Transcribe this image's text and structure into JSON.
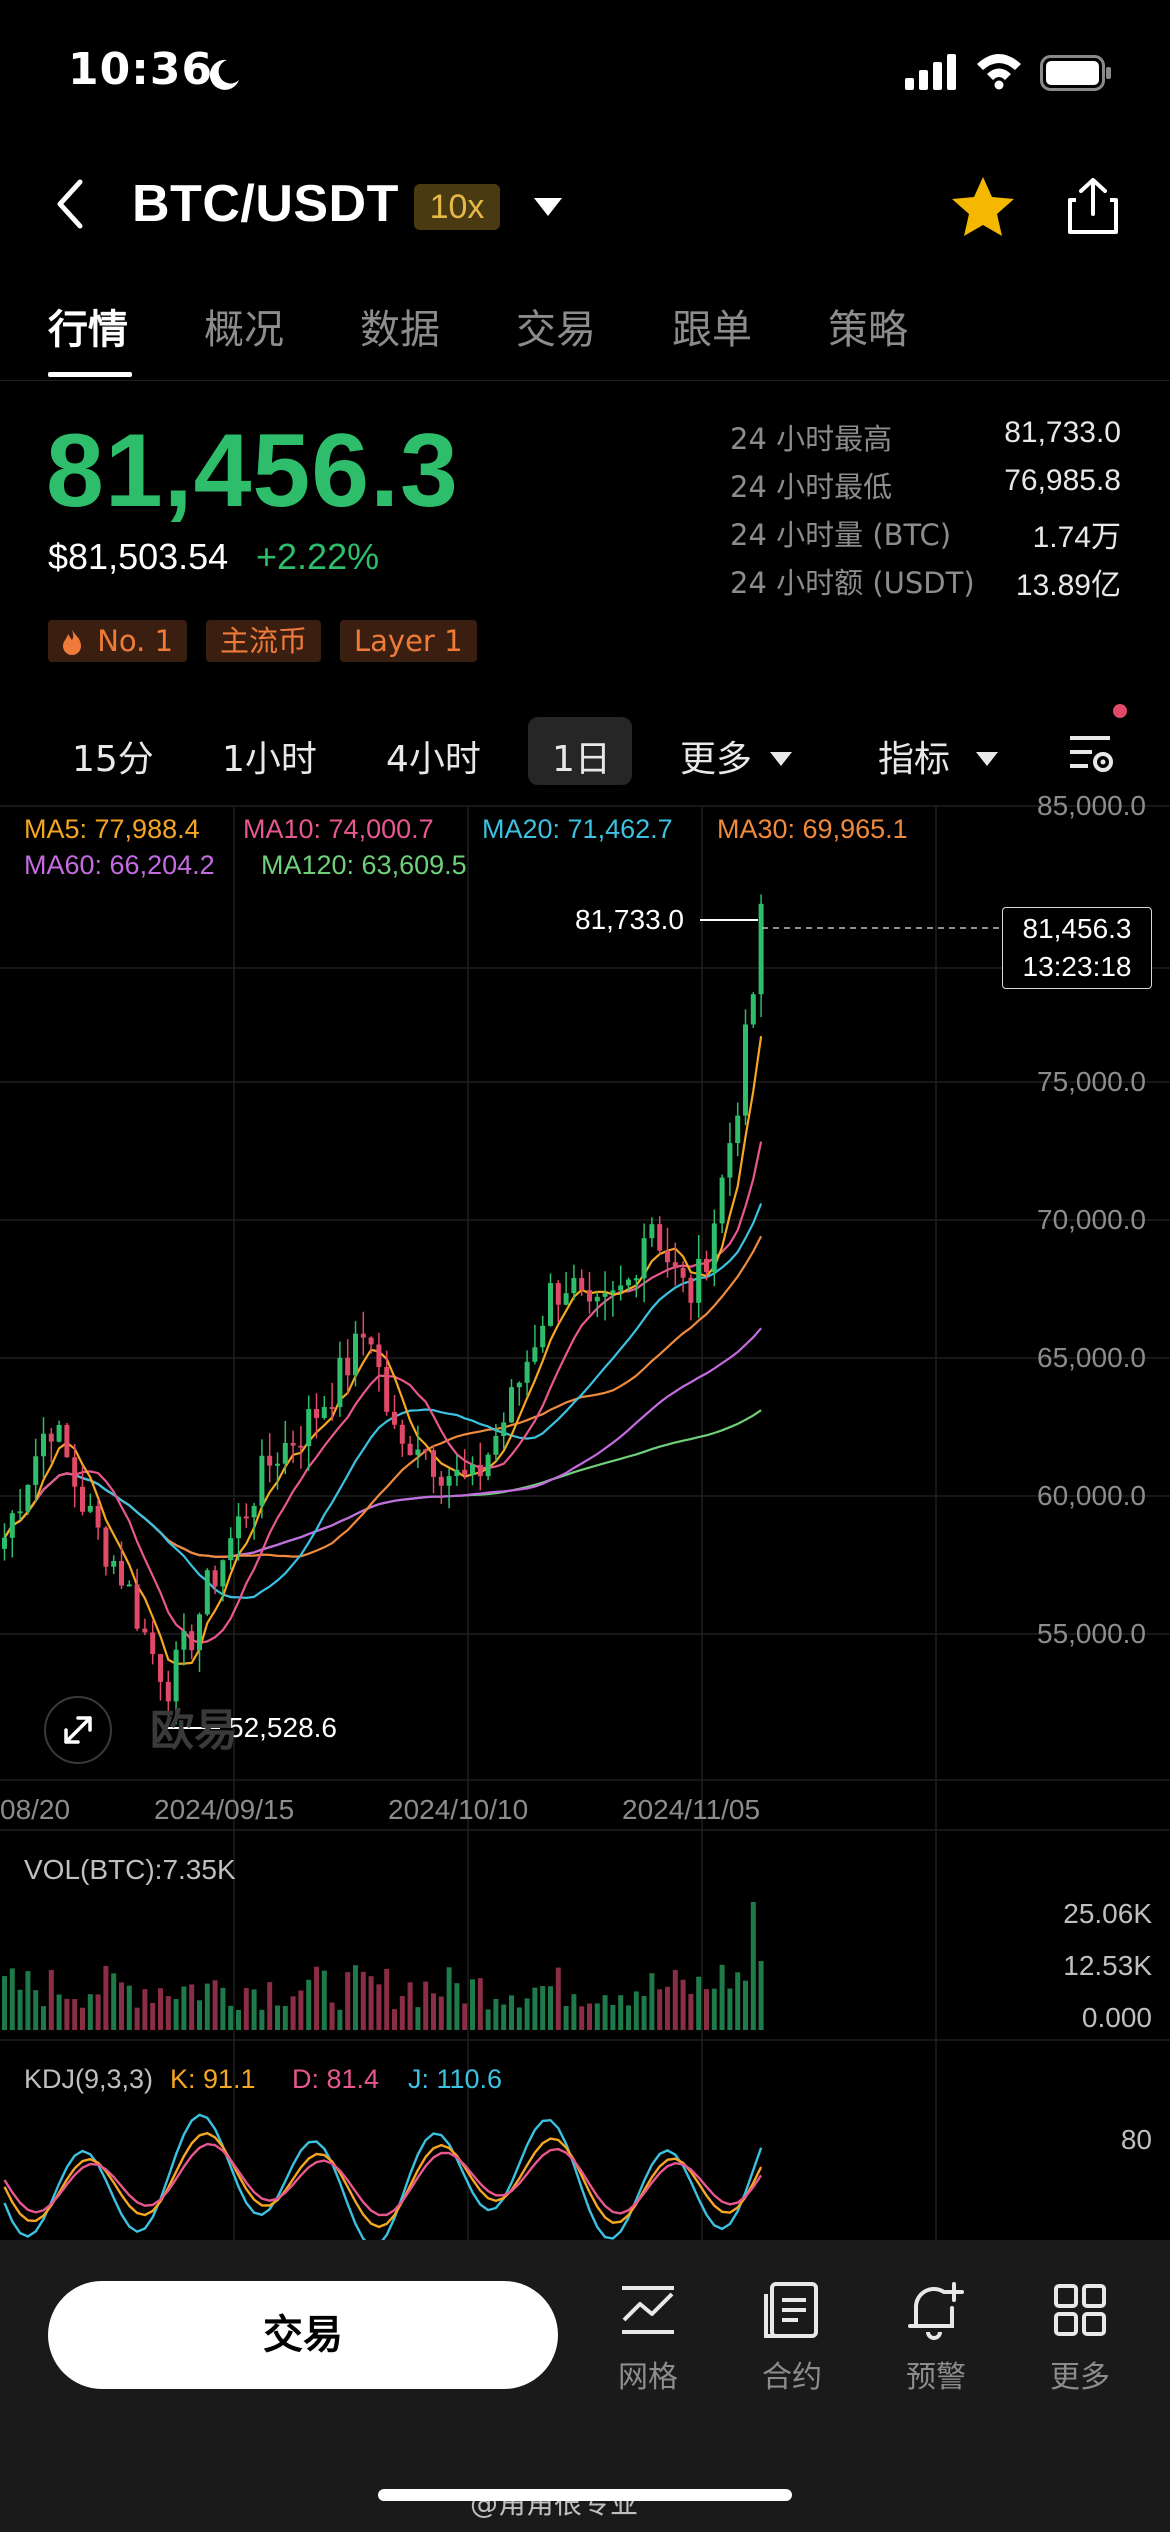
{
  "status": {
    "time": "10:36"
  },
  "header": {
    "pair": "BTC/USDT",
    "leverage": "10x"
  },
  "tabs": [
    "行情",
    "概况",
    "数据",
    "交易",
    "跟单",
    "策略"
  ],
  "price": {
    "last": "81,456.3",
    "usd": "$81,503.54",
    "change": "+2.22%"
  },
  "tags": [
    "No. 1",
    "主流币",
    "Layer 1"
  ],
  "stats": [
    {
      "label": "24 小时最高",
      "value": "81,733.0"
    },
    {
      "label": "24 小时最低",
      "value": "76,985.8"
    },
    {
      "label": "24 小时量 (BTC)",
      "value": "1.74万"
    },
    {
      "label": "24 小时额 (USDT)",
      "value": "13.89亿"
    }
  ],
  "intervals": {
    "m15": "15分",
    "h1": "1小时",
    "h4": "4小时",
    "d1": "1日",
    "more": "更多",
    "indicator": "指标"
  },
  "ma": {
    "ma5": "MA5: 77,988.4",
    "ma10": "MA10: 74,000.7",
    "ma20": "MA20: 71,462.7",
    "ma30": "MA30: 69,965.1",
    "ma60": "MA60: 66,204.2",
    "ma120": "MA120: 63,609.5"
  },
  "colors": {
    "up": "#2ebd6b",
    "down": "#e04a68",
    "ma5": "#f5a623",
    "ma10": "#e8578f",
    "ma20": "#3cc2e0",
    "ma30": "#f08a3c",
    "ma60": "#c46be0",
    "ma120": "#6fd07a"
  },
  "chart": {
    "y_labels": [
      "85,000.0",
      "75,000.0",
      "70,000.0",
      "65,000.0",
      "60,000.0",
      "55,000.0"
    ],
    "x_labels": [
      "08/20",
      "2024/09/15",
      "2024/10/10",
      "2024/11/05"
    ],
    "high_marker": "81,733.0",
    "low_marker": "52,528.6",
    "current_price": "81,456.3",
    "countdown": "13:23:18",
    "watermark": "欧易"
  },
  "volume": {
    "title": "VOL(BTC):7.35K",
    "labels": [
      "25.06K",
      "12.53K",
      "0.000"
    ]
  },
  "kdj": {
    "title": "KDJ(9,3,3)",
    "k": "K: 91.1",
    "d": "D: 81.4",
    "j": "J: 110.6",
    "level": "80"
  },
  "bottom": {
    "trade": "交易",
    "grid": "网格",
    "contract": "合约",
    "alert": "预警",
    "more": "更多"
  },
  "weibo": "@角角很专业",
  "chart_data": {
    "type": "candlestick",
    "ylim": [
      50000,
      86000
    ],
    "x": [
      "08/20",
      "2024/09/15",
      "2024/10/10",
      "2024/11/05"
    ],
    "y_ticks": [
      55000,
      60000,
      65000,
      70000,
      75000,
      85000
    ],
    "high": 81733.0,
    "low": 52528.6,
    "current": 81456.3
  }
}
